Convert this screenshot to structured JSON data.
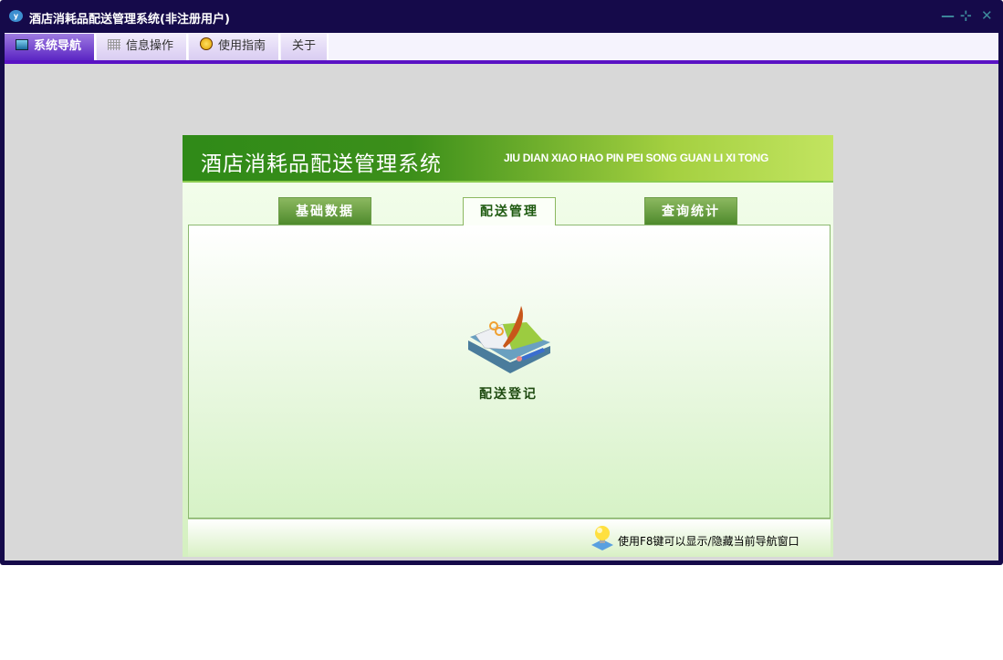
{
  "window": {
    "title": "酒店消耗品配送管理系统(非注册用户)",
    "controls": {
      "minimize": "—",
      "restore": "⊹",
      "close": "✕"
    }
  },
  "menu": {
    "tabs": [
      {
        "label": "系统导航",
        "icon": "monitor-icon",
        "active": true
      },
      {
        "label": "信息操作",
        "icon": "grid-icon",
        "active": false
      },
      {
        "label": "使用指南",
        "icon": "help-icon",
        "active": false
      },
      {
        "label": "关于",
        "active": false
      }
    ]
  },
  "panel": {
    "banner_cn": "酒店消耗品配送管理系统",
    "banner_en": "JIU DIAN XIAO HAO PIN PEI SONG GUAN LI XI TONG",
    "tabs": [
      {
        "label": "基础数据"
      },
      {
        "label": "配送管理",
        "active": true
      },
      {
        "label": "查询统计"
      }
    ],
    "items": [
      {
        "label": "配送登记",
        "icon": "book-icon"
      }
    ],
    "hint": "使用F8键可以显示/隐藏当前导航窗口"
  },
  "colors": {
    "titlebar": "#150a4a",
    "accent": "#5a12c4",
    "green": "#3c8f1a"
  }
}
